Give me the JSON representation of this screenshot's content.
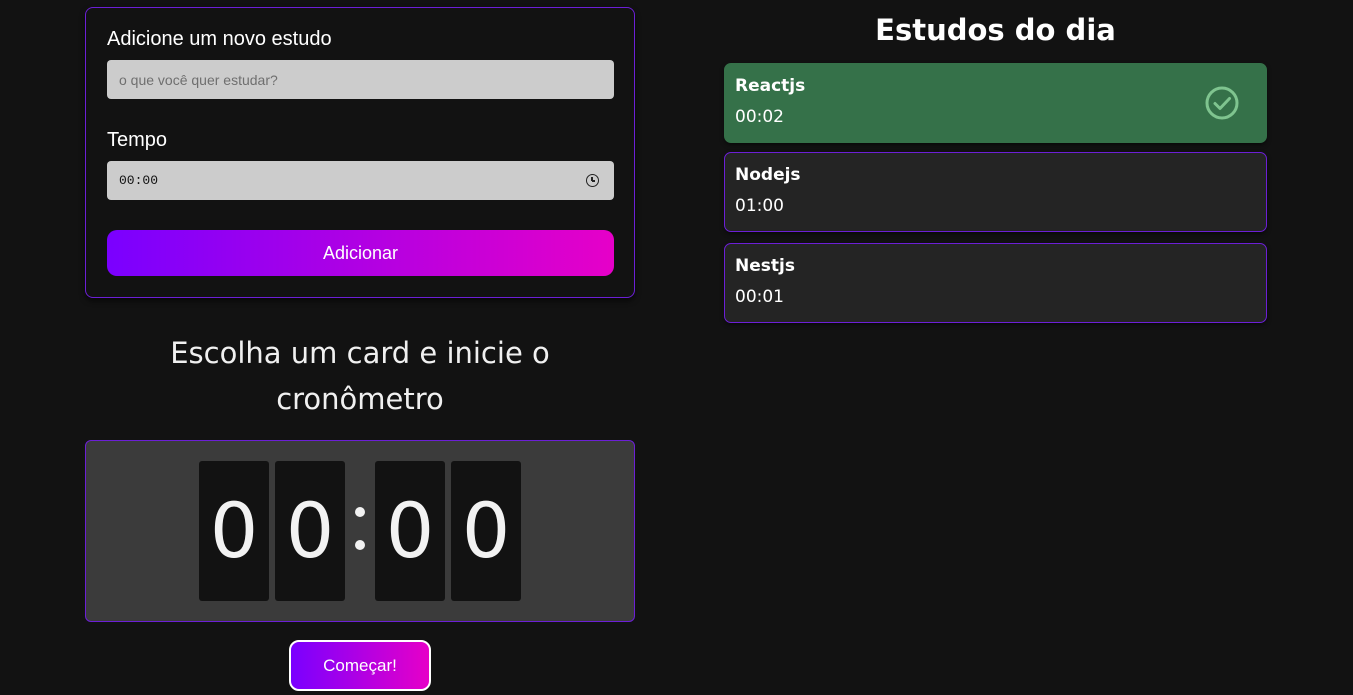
{
  "form": {
    "study_label": "Adicione um novo estudo",
    "study_placeholder": "o que você quer estudar?",
    "time_label": "Tempo",
    "time_value": "00:00",
    "add_button": "Adicionar"
  },
  "timer": {
    "title": "Escolha um card e inicie o cronômetro",
    "digits": [
      "0",
      "0",
      "0",
      "0"
    ],
    "start_button": "Começar!"
  },
  "list": {
    "title": "Estudos do dia",
    "items": [
      {
        "name": "Reactjs",
        "time": "00:02",
        "completed": true,
        "icon": "check-circle-icon"
      },
      {
        "name": "Nodejs",
        "time": "01:00",
        "completed": false
      },
      {
        "name": "Nestjs",
        "time": "00:01",
        "completed": false
      }
    ]
  },
  "colors": {
    "background": "#121212",
    "accent_border": "#6c1fd6",
    "gradient_start": "#7a00ff",
    "gradient_end": "#e600c8",
    "completed_card": "#357149",
    "check_icon": "#7fc48f"
  }
}
